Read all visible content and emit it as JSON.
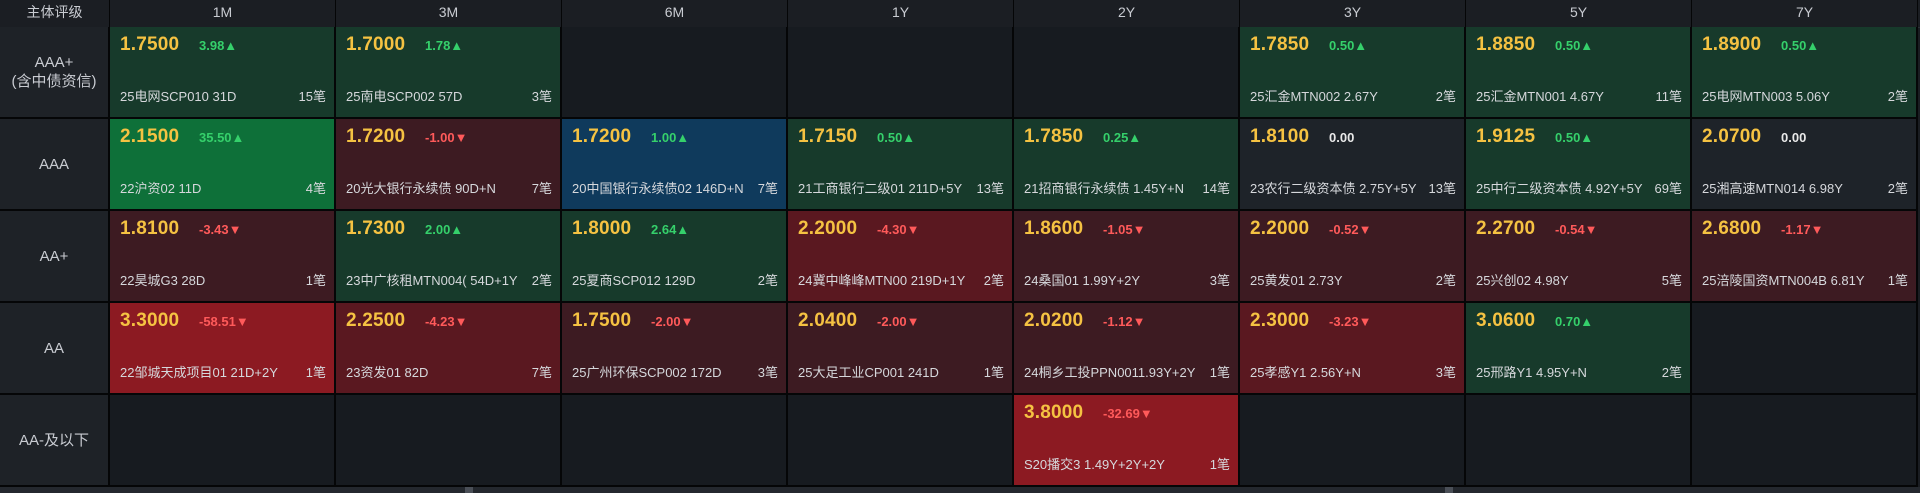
{
  "corner_label": "主体评级",
  "tenors": [
    "1M",
    "3M",
    "6M",
    "1Y",
    "2Y",
    "3Y",
    "5Y",
    "7Y"
  ],
  "rows": [
    {
      "label": "AAA+",
      "sublabel": "(含中债资信)",
      "cells": [
        {
          "rate": "1.7500",
          "chg": "3.98▲",
          "dir": "pos",
          "tone": "up",
          "bond": "25电网SCP010 31D",
          "count": "15笔"
        },
        {
          "rate": "1.7000",
          "chg": "1.78▲",
          "dir": "pos",
          "tone": "up",
          "bond": "25南电SCP002 57D",
          "count": "3笔"
        },
        null,
        null,
        null,
        {
          "rate": "1.7850",
          "chg": "0.50▲",
          "dir": "pos",
          "tone": "up",
          "bond": "25汇金MTN002 2.67Y",
          "count": "2笔"
        },
        {
          "rate": "1.8850",
          "chg": "0.50▲",
          "dir": "pos",
          "tone": "up",
          "bond": "25汇金MTN001 4.67Y",
          "count": "11笔"
        },
        {
          "rate": "1.8900",
          "chg": "0.50▲",
          "dir": "pos",
          "tone": "up",
          "bond": "25电网MTN003 5.06Y",
          "count": "2笔"
        }
      ]
    },
    {
      "label": "AAA",
      "sublabel": "",
      "cells": [
        {
          "rate": "2.1500",
          "chg": "35.50▲",
          "dir": "pos",
          "tone": "up-strong",
          "bond": "22沪资02 11D",
          "count": "4笔"
        },
        {
          "rate": "1.7200",
          "chg": "-1.00▼",
          "dir": "neg",
          "tone": "down",
          "bond": "20光大银行永续债 90D+N",
          "count": "7笔"
        },
        {
          "rate": "1.7200",
          "chg": "1.00▲",
          "dir": "pos",
          "tone": "blue",
          "bond": "20中国银行永续债02 146D+N",
          "count": "7笔"
        },
        {
          "rate": "1.7150",
          "chg": "0.50▲",
          "dir": "pos",
          "tone": "up",
          "bond": "21工商银行二级01 211D+5Y",
          "count": "13笔"
        },
        {
          "rate": "1.7850",
          "chg": "0.25▲",
          "dir": "pos",
          "tone": "up",
          "bond": "21招商银行永续债 1.45Y+N",
          "count": "14笔"
        },
        {
          "rate": "1.8100",
          "chg": "0.00",
          "dir": "zero",
          "tone": "flat",
          "bond": "23农行二级资本债 2.75Y+5Y",
          "count": "13笔"
        },
        {
          "rate": "1.9125",
          "chg": "0.50▲",
          "dir": "pos",
          "tone": "up",
          "bond": "25中行二级资本债 4.92Y+5Y",
          "count": "69笔"
        },
        {
          "rate": "2.0700",
          "chg": "0.00",
          "dir": "zero",
          "tone": "flat",
          "bond": "25湘高速MTN014 6.98Y",
          "count": "2笔"
        }
      ]
    },
    {
      "label": "AA+",
      "sublabel": "",
      "cells": [
        {
          "rate": "1.8100",
          "chg": "-3.43▼",
          "dir": "neg",
          "tone": "down",
          "bond": "22昊城G3 28D",
          "count": "1笔"
        },
        {
          "rate": "1.7300",
          "chg": "2.00▲",
          "dir": "pos",
          "tone": "up",
          "bond": "23中广核租MTN004( 54D+1Y",
          "count": "2笔"
        },
        {
          "rate": "1.8000",
          "chg": "2.64▲",
          "dir": "pos",
          "tone": "up",
          "bond": "25夏商SCP012 129D",
          "count": "2笔"
        },
        {
          "rate": "2.2000",
          "chg": "-4.30▼",
          "dir": "neg",
          "tone": "down-mid",
          "bond": "24冀中峰峰MTN00 219D+1Y",
          "count": "2笔"
        },
        {
          "rate": "1.8600",
          "chg": "-1.05▼",
          "dir": "neg",
          "tone": "down",
          "bond": "24桑国01 1.99Y+2Y",
          "count": "3笔"
        },
        {
          "rate": "2.2000",
          "chg": "-0.52▼",
          "dir": "neg",
          "tone": "down",
          "bond": "25黄发01 2.73Y",
          "count": "2笔"
        },
        {
          "rate": "2.2700",
          "chg": "-0.54▼",
          "dir": "neg",
          "tone": "down",
          "bond": "25兴创02 4.98Y",
          "count": "5笔"
        },
        {
          "rate": "2.6800",
          "chg": "-1.17▼",
          "dir": "neg",
          "tone": "down",
          "bond": "25涪陵国资MTN004B 6.81Y",
          "count": "1笔"
        }
      ]
    },
    {
      "label": "AA",
      "sublabel": "",
      "cells": [
        {
          "rate": "3.3000",
          "chg": "-58.51▼",
          "dir": "neg",
          "tone": "down-strong",
          "bond": "22邹城天成项目01 21D+2Y",
          "count": "1笔"
        },
        {
          "rate": "2.2500",
          "chg": "-4.23▼",
          "dir": "neg",
          "tone": "down-mid",
          "bond": "23资发01 82D",
          "count": "7笔"
        },
        {
          "rate": "1.7500",
          "chg": "-2.00▼",
          "dir": "neg",
          "tone": "down",
          "bond": "25广州环保SCP002 172D",
          "count": "3笔"
        },
        {
          "rate": "2.0400",
          "chg": "-2.00▼",
          "dir": "neg",
          "tone": "down",
          "bond": "25大足工业CP001 241D",
          "count": "1笔"
        },
        {
          "rate": "2.0200",
          "chg": "-1.12▼",
          "dir": "neg",
          "tone": "down",
          "bond": "24桐乡工投PPN0011.93Y+2Y",
          "count": "1笔"
        },
        {
          "rate": "2.3000",
          "chg": "-3.23▼",
          "dir": "neg",
          "tone": "down-mid",
          "bond": "25孝感Y1 2.56Y+N",
          "count": "3笔"
        },
        {
          "rate": "3.0600",
          "chg": "0.70▲",
          "dir": "pos",
          "tone": "up",
          "bond": "25邢路Y1 4.95Y+N",
          "count": "2笔"
        },
        null
      ]
    },
    {
      "label": "AA-及以下",
      "sublabel": "",
      "cells": [
        null,
        null,
        null,
        null,
        {
          "rate": "3.8000",
          "chg": "-32.69▼",
          "dir": "neg",
          "tone": "down-strong",
          "bond": "S20播交3 1.49Y+2Y+2Y",
          "count": "1笔"
        },
        null,
        null,
        null
      ]
    }
  ],
  "colors": {
    "rate": "#f5c242",
    "up_change": "#35d06b",
    "down_change": "#ff5a5a",
    "cell_up": "#173a2b",
    "cell_up_strong": "#0e7039",
    "cell_down": "#3d1b22",
    "cell_down_strong": "#8c1a22",
    "cell_blue": "#0f3a5c"
  }
}
